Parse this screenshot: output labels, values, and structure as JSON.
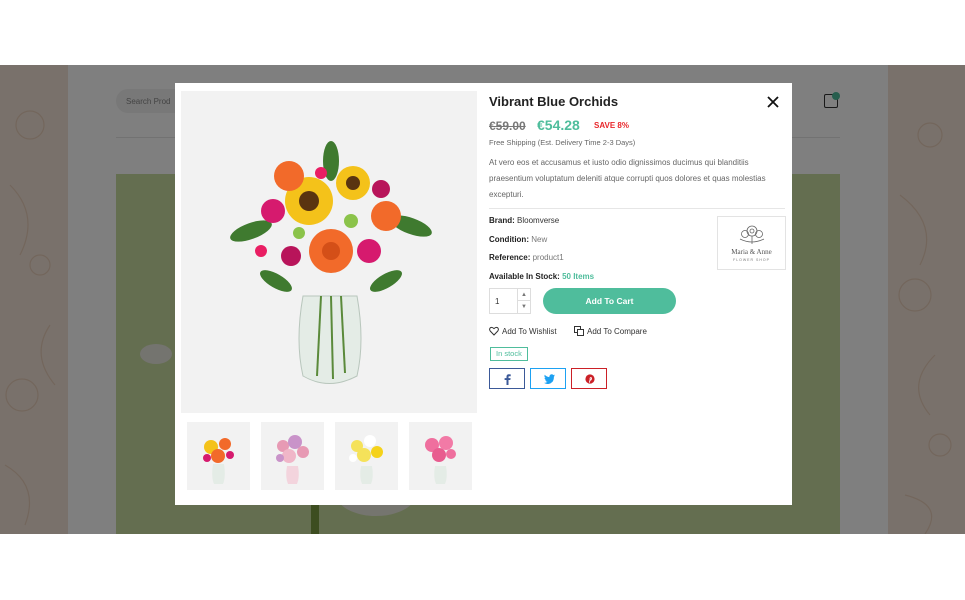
{
  "background_page": {
    "search_placeholder": "Search Prod"
  },
  "modal": {
    "title": "Vibrant Blue Orchids",
    "old_price": "€59.00",
    "new_price": "€54.28",
    "save_label": "SAVE 8%",
    "shipping": "Free Shipping (Est. Delivery Time 2-3 Days)",
    "description": "At vero eos et accusamus et iusto odio dignissimos ducimus qui blanditiis praesentium voluptatum deleniti atque corrupti quos dolores et quas molestias excepturi.",
    "brand_label": "Brand:",
    "brand_value": "Bloomverse",
    "condition_label": "Condition:",
    "condition_value": "New",
    "reference_label": "Reference:",
    "reference_value": "product1",
    "stock_label": "Available In Stock:",
    "stock_value": "50 Items",
    "brand_logo_name": "Maria & Anne",
    "brand_logo_sub": "FLOWER SHOP",
    "quantity": "1",
    "add_to_cart": "Add To Cart",
    "wishlist": "Add To Wishlist",
    "compare": "Add To Compare",
    "stock_badge": "In stock",
    "share": [
      "facebook-icon",
      "twitter-icon",
      "pinterest-icon"
    ],
    "thumbnails": [
      "sunflower-bouquet",
      "pink-mixed-bouquet",
      "yellow-daisy-bouquet",
      "pink-rose-bouquet"
    ]
  },
  "colors": {
    "accent": "#4fbd9c",
    "sale": "#e8262a",
    "facebook": "#3b5998",
    "twitter": "#1da1f2",
    "pinterest": "#cb2027"
  }
}
